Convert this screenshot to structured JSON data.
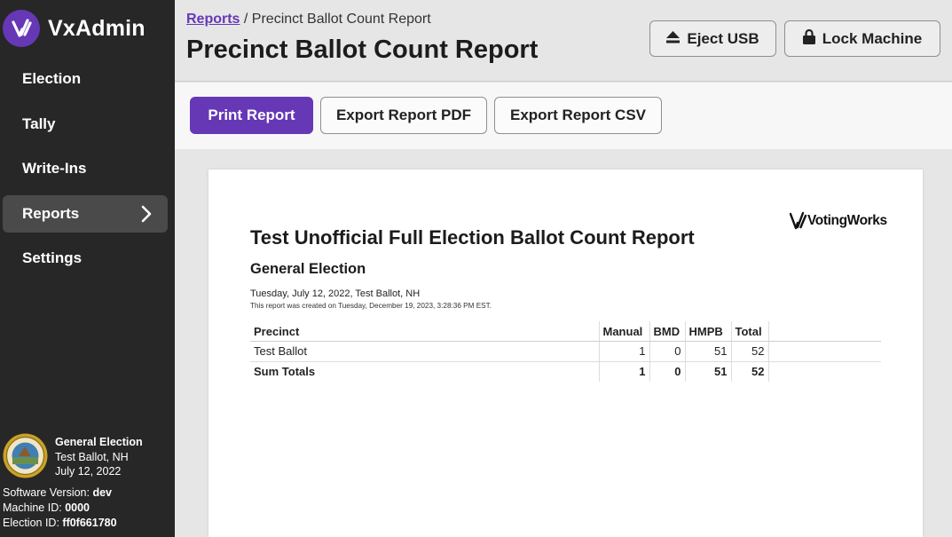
{
  "sidebar": {
    "brand": "VxAdmin",
    "items": [
      {
        "label": "Election"
      },
      {
        "label": "Tally"
      },
      {
        "label": "Write-Ins"
      },
      {
        "label": "Reports",
        "active": true
      },
      {
        "label": "Settings"
      }
    ],
    "election": {
      "title": "General Election",
      "place": "Test Ballot, NH",
      "date": "July 12, 2022"
    },
    "software_version_label": "Software Version:",
    "software_version": "dev",
    "machine_id_label": "Machine ID:",
    "machine_id": "0000",
    "election_id_label": "Election ID:",
    "election_id": "ff0f661780"
  },
  "header": {
    "breadcrumb_link": "Reports",
    "breadcrumb_sep": " / ",
    "breadcrumb_current": "Precinct Ballot Count Report",
    "title": "Precinct Ballot Count Report",
    "eject_label": "Eject USB",
    "lock_label": "Lock Machine"
  },
  "toolbar": {
    "print_label": "Print Report",
    "pdf_label": "Export Report PDF",
    "csv_label": "Export Report CSV"
  },
  "report": {
    "logo_text": "VotingWorks",
    "title": "Test Unofficial Full Election Ballot Count Report",
    "subtitle": "General Election",
    "date_line": "Tuesday, July 12, 2022, Test Ballot, NH",
    "created_line": "This report was created on Tuesday, December 19, 2023, 3:28:36 PM EST.",
    "columns": [
      "Precinct",
      "Manual",
      "BMD",
      "HMPB",
      "Total"
    ],
    "rows": [
      {
        "precinct": "Test Ballot",
        "manual": "1",
        "bmd": "0",
        "hmpb": "51",
        "total": "52"
      }
    ],
    "sum": {
      "label": "Sum Totals",
      "manual": "1",
      "bmd": "0",
      "hmpb": "51",
      "total": "52"
    }
  },
  "colors": {
    "accent": "#6638b6",
    "sidebar_bg": "#272727"
  }
}
